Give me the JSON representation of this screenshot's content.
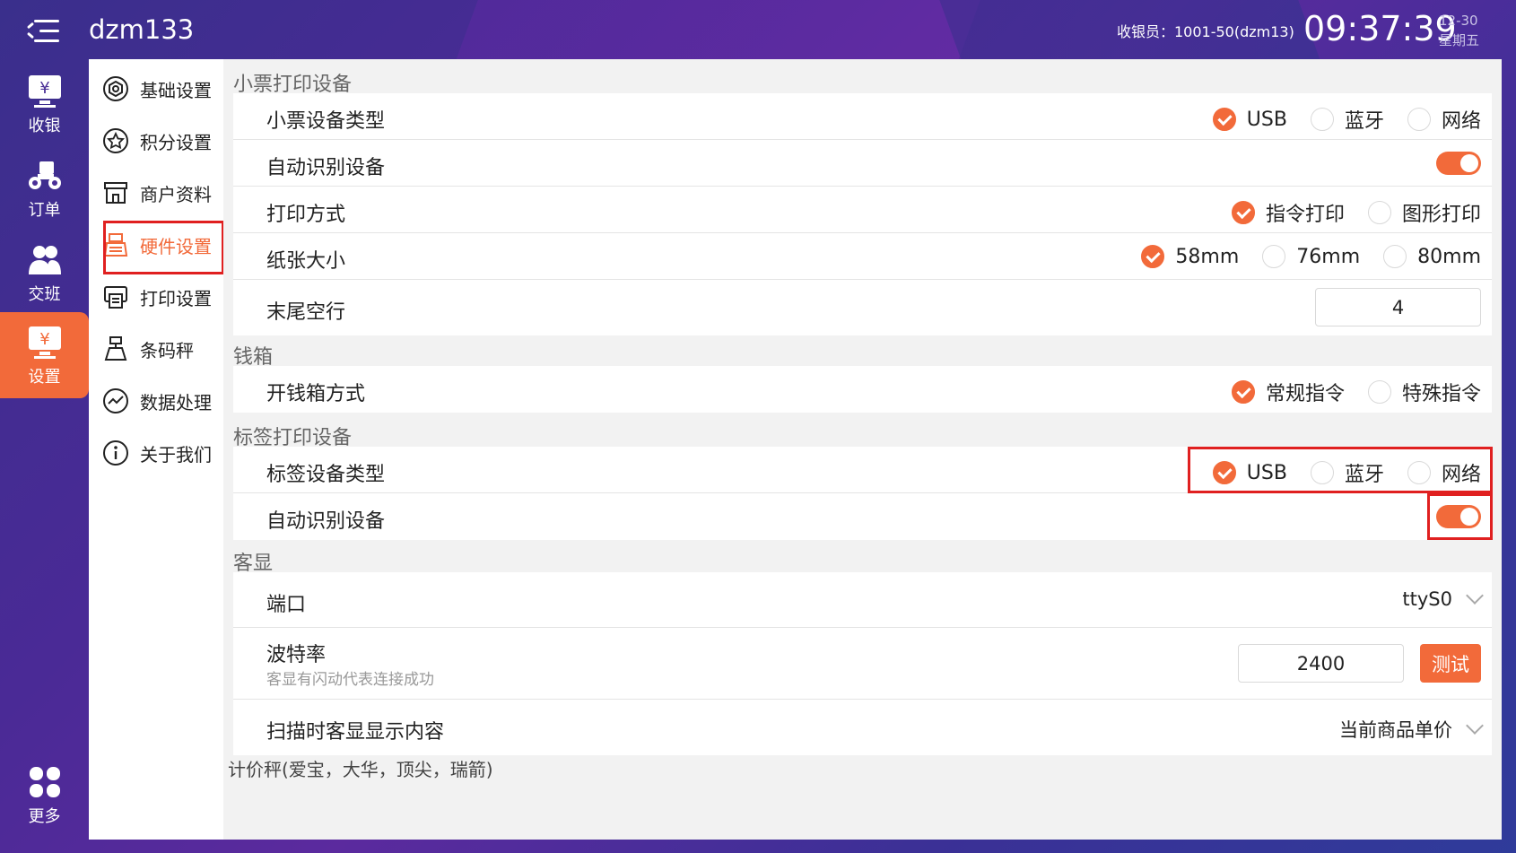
{
  "header": {
    "app_title": "dzm133",
    "cashier": "收银员：1001-50(dzm13)",
    "time": "09:37:39",
    "date": "12-30",
    "weekday": "星期五"
  },
  "rail": {
    "items": [
      {
        "label": "收银",
        "icon": "cashier-icon"
      },
      {
        "label": "订单",
        "icon": "order-icon"
      },
      {
        "label": "交班",
        "icon": "shift-icon"
      },
      {
        "label": "设置",
        "icon": "settings-icon",
        "active": true
      },
      {
        "label": "更多",
        "icon": "more-icon"
      }
    ]
  },
  "nav": {
    "items": [
      {
        "label": "基础设置",
        "icon": "hexagon-gear-icon"
      },
      {
        "label": "积分设置",
        "icon": "star-circle-icon"
      },
      {
        "label": "商户资料",
        "icon": "store-icon"
      },
      {
        "label": "硬件设置",
        "icon": "cash-register-icon",
        "active": true
      },
      {
        "label": "打印设置",
        "icon": "printer-icon"
      },
      {
        "label": "条码秤",
        "icon": "scale-icon"
      },
      {
        "label": "数据处理",
        "icon": "chart-circle-icon"
      },
      {
        "label": "关于我们",
        "icon": "info-icon"
      }
    ]
  },
  "receipt": {
    "title": "小票打印设备",
    "device_type": {
      "label": "小票设备类型",
      "options": [
        "USB",
        "蓝牙",
        "网络"
      ],
      "selected": "USB"
    },
    "auto_detect": {
      "label": "自动识别设备",
      "on": true
    },
    "print_mode": {
      "label": "打印方式",
      "options": [
        "指令打印",
        "图形打印"
      ],
      "selected": "指令打印"
    },
    "paper_size": {
      "label": "纸张大小",
      "options": [
        "58mm",
        "76mm",
        "80mm"
      ],
      "selected": "58mm"
    },
    "tail_lines": {
      "label": "末尾空行",
      "value": "4"
    }
  },
  "cashbox": {
    "title": "钱箱",
    "open_mode": {
      "label": "开钱箱方式",
      "options": [
        "常规指令",
        "特殊指令"
      ],
      "selected": "常规指令"
    }
  },
  "label_printer": {
    "title": "标签打印设备",
    "device_type": {
      "label": "标签设备类型",
      "options": [
        "USB",
        "蓝牙",
        "网络"
      ],
      "selected": "USB"
    },
    "auto_detect": {
      "label": "自动识别设备",
      "on": true
    }
  },
  "customer_display": {
    "title": "客显",
    "port": {
      "label": "端口",
      "value": "ttyS0"
    },
    "baud": {
      "label": "波特率",
      "hint": "客显有闪动代表连接成功",
      "value": "2400",
      "test_label": "测试"
    },
    "scan_content": {
      "label": "扫描时客显显示内容",
      "value": "当前商品单价"
    },
    "partial_next": "计价秤(爱宝，大华，顶尖，瑞箭)"
  },
  "colors": {
    "accent": "#f26a3a",
    "highlight": "#e02020"
  }
}
